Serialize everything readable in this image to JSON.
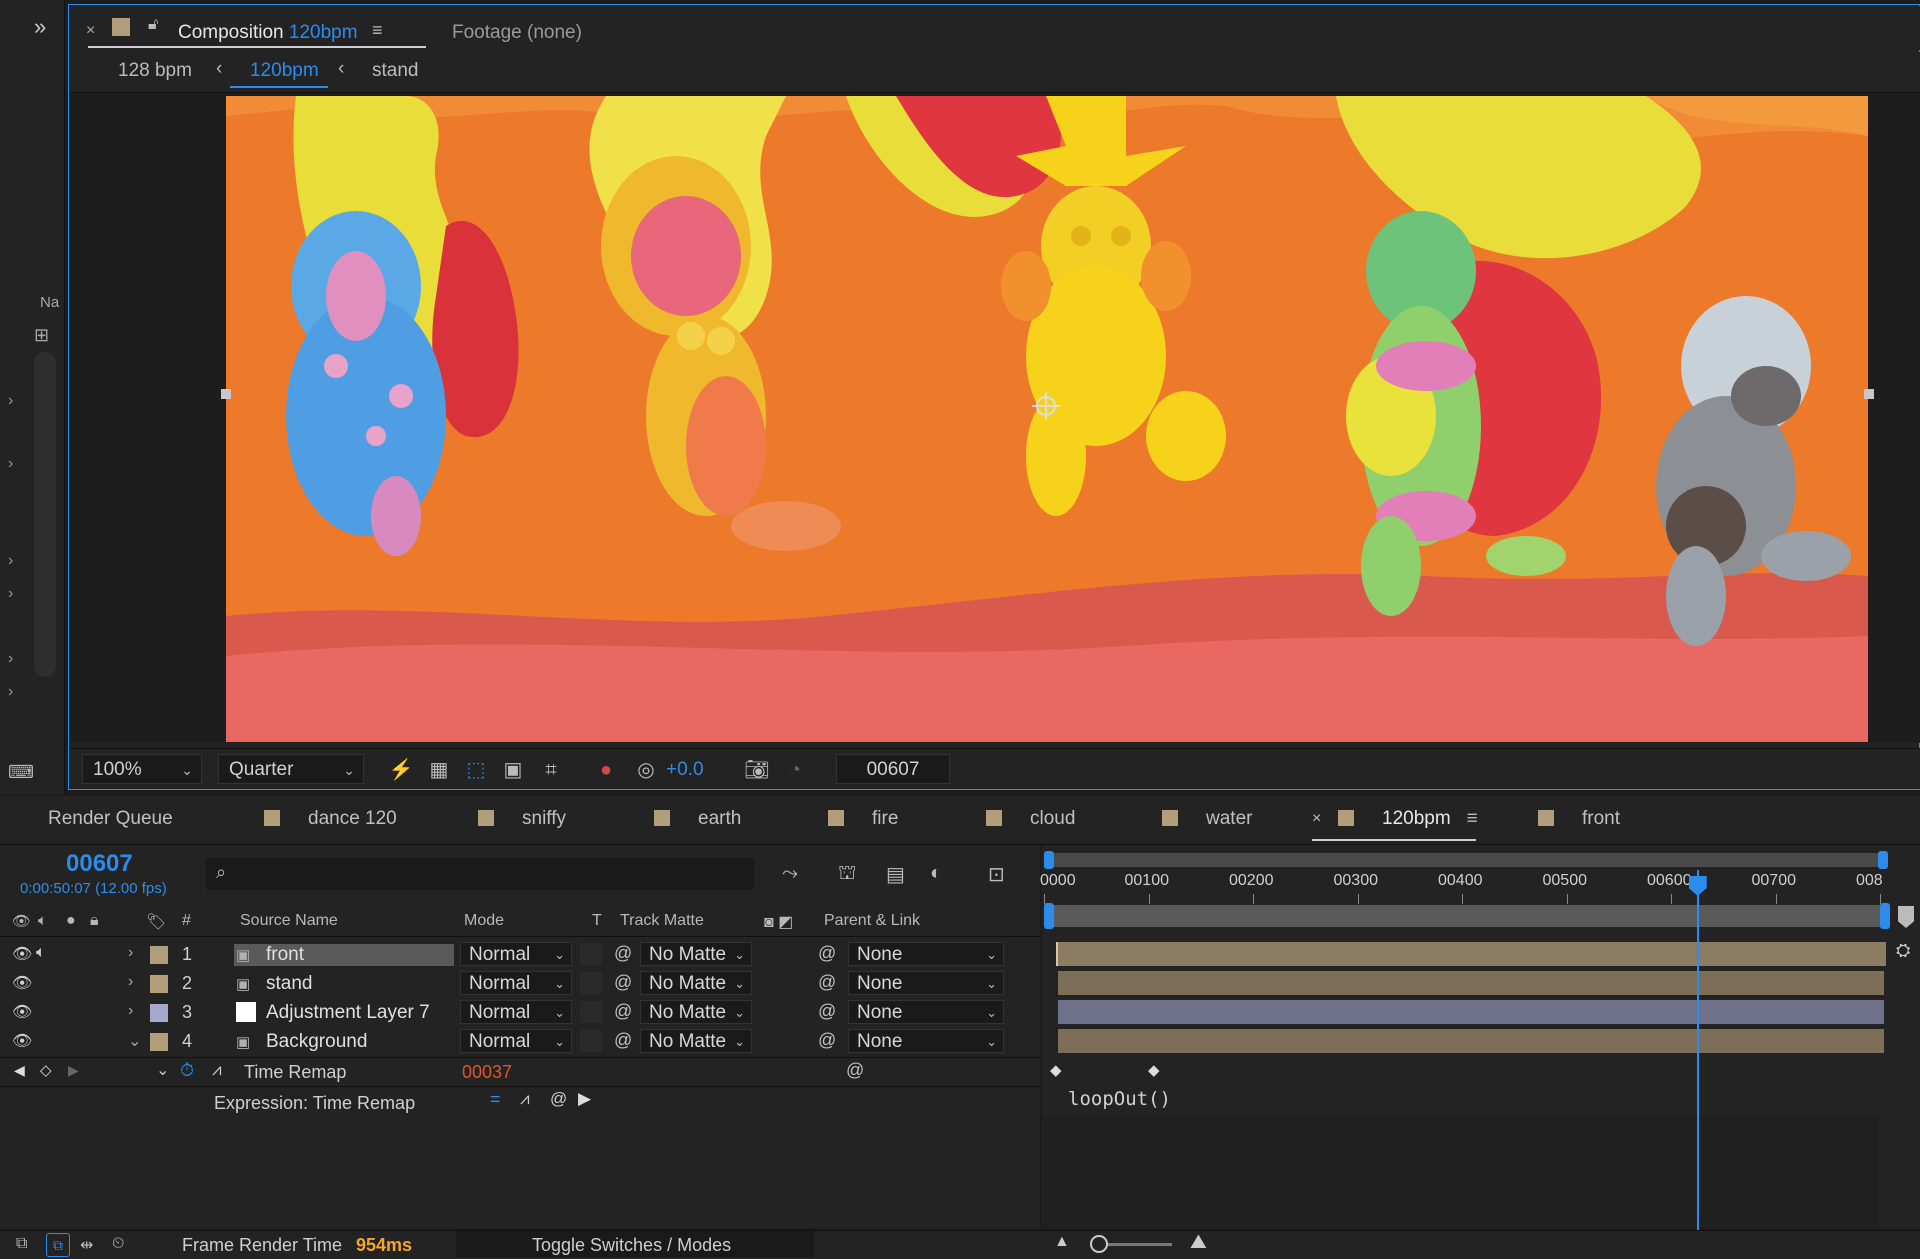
{
  "left_panel": {
    "expand_label": "»",
    "name_col": "Na"
  },
  "viewer": {
    "tabs": [
      {
        "label": "Composition",
        "comp": "120bpm"
      },
      {
        "label": "Footage (none)"
      }
    ],
    "breadcrumbs": [
      "128 bpm",
      "120bpm",
      "stand"
    ],
    "toolbar": {
      "zoom": "100%",
      "resolution": "Quarter",
      "exposure": "+0.0",
      "timecode": "00607"
    }
  },
  "timeline": {
    "tabs": [
      "Render Queue",
      "dance 120",
      "sniffy",
      "earth",
      "fire",
      "cloud",
      "water",
      "120bpm",
      "front"
    ],
    "active_tab": "120bpm",
    "current_time": "00607",
    "current_time_sub": "0:00:50:07 (12.00 fps)",
    "search_placeholder": "",
    "columns": {
      "num": "#",
      "source_name": "Source Name",
      "mode": "Mode",
      "t": "T",
      "track_matte": "Track Matte",
      "parent": "Parent & Link"
    },
    "layers": [
      {
        "num": "1",
        "name": "front",
        "mode": "Normal",
        "matte": "No Matte",
        "parent": "None",
        "color": "#b29e7b",
        "bar_color": "#8c7c62"
      },
      {
        "num": "2",
        "name": "stand",
        "mode": "Normal",
        "matte": "No Matte",
        "parent": "None",
        "color": "#b29e7b",
        "bar_color": "#7d6f57"
      },
      {
        "num": "3",
        "name": "Adjustment Layer 7",
        "mode": "Normal",
        "matte": "No Matte",
        "parent": "None",
        "color": "#a7a9cc",
        "bar_color": "#6f708a"
      },
      {
        "num": "4",
        "name": "Background",
        "mode": "Normal",
        "matte": "No Matte",
        "parent": "None",
        "color": "#b29e7b",
        "bar_color": "#7d6f57"
      }
    ],
    "property": {
      "name": "Time Remap",
      "value": "00037"
    },
    "expression": {
      "label": "Expression: Time Remap",
      "code": "loopOut()"
    },
    "ruler": [
      "0000",
      "00100",
      "00200",
      "00300",
      "00400",
      "00500",
      "00600",
      "00700",
      "008"
    ],
    "playhead_fraction": 0.776
  },
  "status": {
    "render_label": "Frame Render Time",
    "render_value": "954ms",
    "toggle_label": "Toggle Switches / Modes"
  }
}
